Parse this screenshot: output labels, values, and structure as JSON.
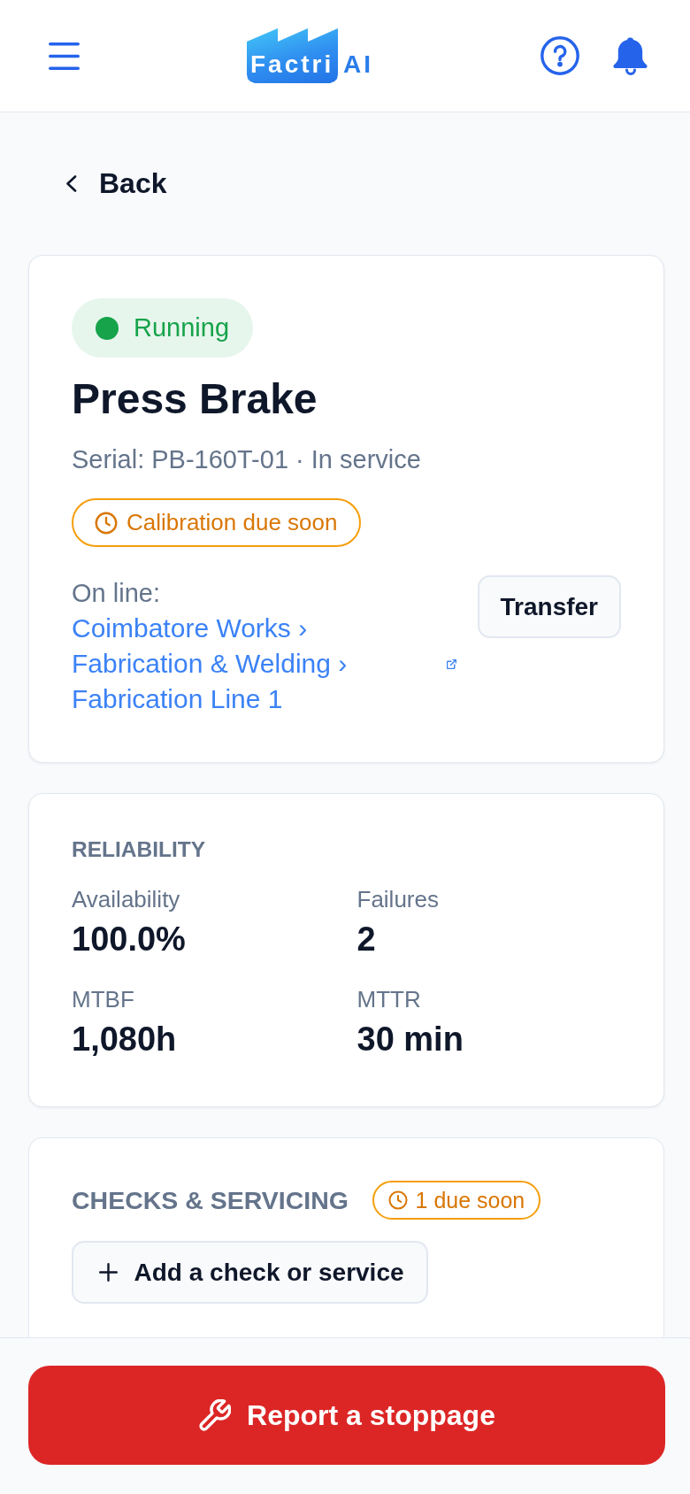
{
  "header": {
    "logo": {
      "badge_text": "Factri",
      "text": "AI"
    }
  },
  "back_link": {
    "label": "Back"
  },
  "asset": {
    "status": {
      "label": "Running",
      "color": "#16a34a"
    },
    "name": "Press Brake",
    "subtitle": "Serial: PB-160T-01 · In service",
    "alert": {
      "label": "Calibration due soon",
      "kind": "warning"
    },
    "location": {
      "label": "On line:",
      "path": [
        "Coimbatore Works ›",
        "Fabrication & Welding ›",
        "Fabrication Line 1"
      ]
    },
    "transfer_button": {
      "label": "Transfer"
    }
  },
  "reliability": {
    "title": "RELIABILITY",
    "metrics": [
      {
        "label": "Availability",
        "value": "100.0%"
      },
      {
        "label": "Failures",
        "value": "2"
      },
      {
        "label": "MTBF",
        "value": "1,080h"
      },
      {
        "label": "MTTR",
        "value": "30 min"
      }
    ]
  },
  "checks": {
    "title": "CHECKS & SERVICING",
    "badge": {
      "label": "1 due soon",
      "kind": "warning"
    },
    "add_button": {
      "label": "Add a check or service"
    }
  },
  "footer": {
    "report_button": {
      "label": "Report a stoppage"
    }
  }
}
